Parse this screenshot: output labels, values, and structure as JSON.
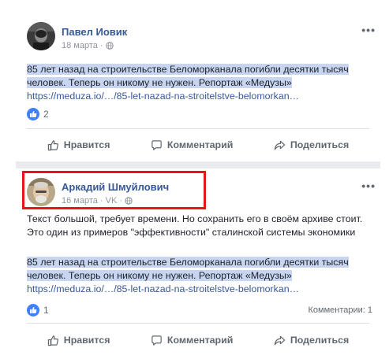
{
  "posts": [
    {
      "author": "Павел Иовик",
      "meta": "18 марта",
      "meta_separator": "·",
      "text": "",
      "share_text": "85 лет назад на строительстве Беломорканала погибли десятки тысяч человек. Теперь он никому не нужен. Репортаж «Медузы»",
      "link": "https://meduza.io/…/85-let-nazad-na-stroitelstve-belomorkan…",
      "likes": "2",
      "comments": ""
    },
    {
      "author": "Аркадий Шмуйлович",
      "meta": "16 марта · VK",
      "meta_separator": "·",
      "text": "Текст большой, требует времени. Но сохранить его в своём архиве стоит. Это один из примеров \"эффективности\" сталинской системы экономики",
      "share_text": "85 лет назад на строительстве Беломорканала погибли десятки тысяч человек. Теперь он никому не нужен. Репортаж «Медузы»",
      "link": "https://meduza.io/…/85-let-nazad-na-stroitelstve-belomorkan…",
      "likes": "1",
      "comments": "Комментарии: 1"
    }
  ],
  "actions": {
    "like": "Нравится",
    "comment": "Комментарий",
    "share": "Поделиться"
  },
  "more_glyph": "•••",
  "colors": {
    "name": "#365899",
    "link": "#385898",
    "selection": "#c7d5f0",
    "highlight_border": "#e8131c",
    "like_badge": "#4080ff"
  }
}
